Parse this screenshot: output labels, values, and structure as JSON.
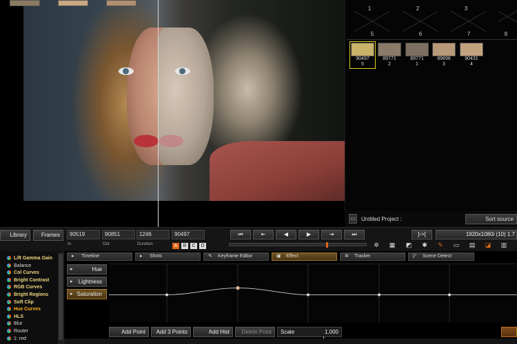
{
  "gallery": {
    "top_numbers": [
      "1",
      "2",
      "3"
    ],
    "empty_slots": [
      "5",
      "6",
      "7",
      "8"
    ],
    "thumbnails": [
      {
        "timecode": "90497",
        "index": "5",
        "selected": true,
        "color": "#c9b26a"
      },
      {
        "timecode": "89771",
        "index": "2",
        "selected": false,
        "color": "#8a7a68"
      },
      {
        "timecode": "89771",
        "index": "1",
        "selected": false,
        "color": "#7d7060"
      },
      {
        "timecode": "89896",
        "index": "3",
        "selected": false,
        "color": "#b89a78"
      },
      {
        "timecode": "90431",
        "index": "4",
        "selected": false,
        "color": "#c2a37e"
      }
    ],
    "project_label": "Untitled Project :",
    "sort_label": "Sort source"
  },
  "transport": {
    "library_label": "Library",
    "frames_label": "Frames",
    "in_value": "90519",
    "out_value": "90851",
    "duration_value": "1246",
    "current_value": "90497",
    "in_label": "In",
    "out_label": "Out",
    "duration_label": "Duration",
    "inout_label": "]->[",
    "resolution": "1920x1080i (10) 1.7",
    "abcd": [
      "A",
      "B",
      "C",
      "D"
    ]
  },
  "effects": {
    "items": [
      {
        "label": "Lift Gamma Gain",
        "style": "hl"
      },
      {
        "label": "Balance",
        "style": "plain"
      },
      {
        "label": "Col Curves",
        "style": "hl"
      },
      {
        "label": "Bright Contrast",
        "style": "hl"
      },
      {
        "label": "RGB Curves",
        "style": "hl"
      },
      {
        "label": "Bright Regions",
        "style": "hl"
      },
      {
        "label": "Soft Clip",
        "style": "hl"
      },
      {
        "label": "Hue Curves",
        "style": "red"
      },
      {
        "label": "HLS",
        "style": "hl"
      },
      {
        "label": "Blur",
        "style": "plain"
      },
      {
        "label": "Router",
        "style": "plain"
      },
      {
        "label": "1: red",
        "style": "plain"
      }
    ]
  },
  "tabs": [
    "Timeline",
    "Shots",
    "Keyframe Editor",
    "Effect",
    "Tracker",
    "Scene Detect"
  ],
  "curve_modes": [
    "Hue",
    "Lightness",
    "Saturation"
  ],
  "buttons": {
    "add_point": "Add Point",
    "add_3_points": "Add 3 Points",
    "add_hist": "Add Hist",
    "delete_point": "Delete Point",
    "scale_label": "Scale",
    "scale_value": "1.000"
  }
}
